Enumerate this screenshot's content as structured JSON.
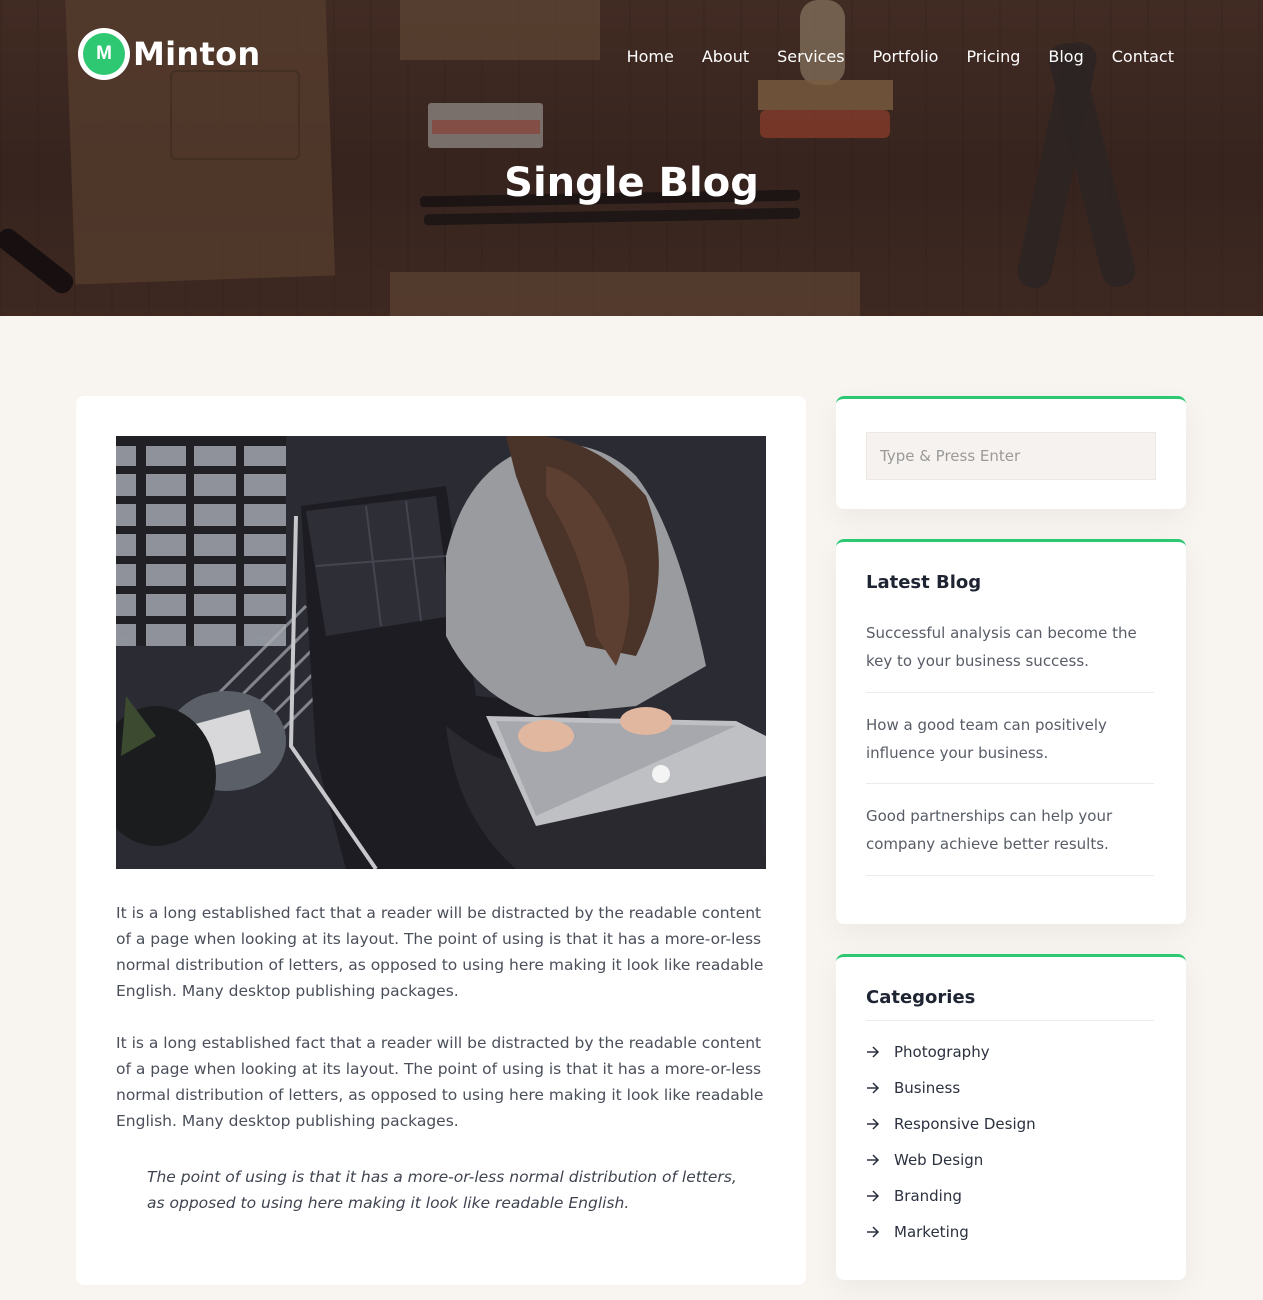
{
  "brand": {
    "badge_letter": "M",
    "name": "Minton",
    "accent": "#2ec872"
  },
  "nav": {
    "items": [
      {
        "label": "Home"
      },
      {
        "label": "About"
      },
      {
        "label": "Services"
      },
      {
        "label": "Portfolio"
      },
      {
        "label": "Pricing"
      },
      {
        "label": "Blog"
      },
      {
        "label": "Contact"
      }
    ]
  },
  "hero": {
    "title": "Single Blog"
  },
  "article": {
    "paragraphs": [
      "It is a long established fact that a reader will be distracted by the readable content of a page when looking at its layout. The point of using is that it has a more-or-less normal distribution of letters, as opposed to using here making it look like readable English. Many desktop publishing packages.",
      "It is a long established fact that a reader will be distracted by the readable content of a page when looking at its layout. The point of using is that it has a more-or-less normal distribution of letters, as opposed to using here making it look like readable English. Many desktop publishing packages."
    ],
    "quote": "The point of using is that it has a more-or-less normal distribution of letters, as opposed to using here making it look like readable English."
  },
  "sidebar": {
    "search": {
      "placeholder": "Type & Press Enter"
    },
    "latest": {
      "title": "Latest Blog",
      "posts": [
        {
          "title": "Successful analysis can become the key to your business success."
        },
        {
          "title": "How a good team can positively influence your business."
        },
        {
          "title": "Good partnerships can help your company achieve better results."
        }
      ]
    },
    "categories": {
      "title": "Categories",
      "items": [
        {
          "label": "Photography"
        },
        {
          "label": "Business"
        },
        {
          "label": "Responsive Design"
        },
        {
          "label": "Web Design"
        },
        {
          "label": "Branding"
        },
        {
          "label": "Marketing"
        }
      ]
    }
  }
}
